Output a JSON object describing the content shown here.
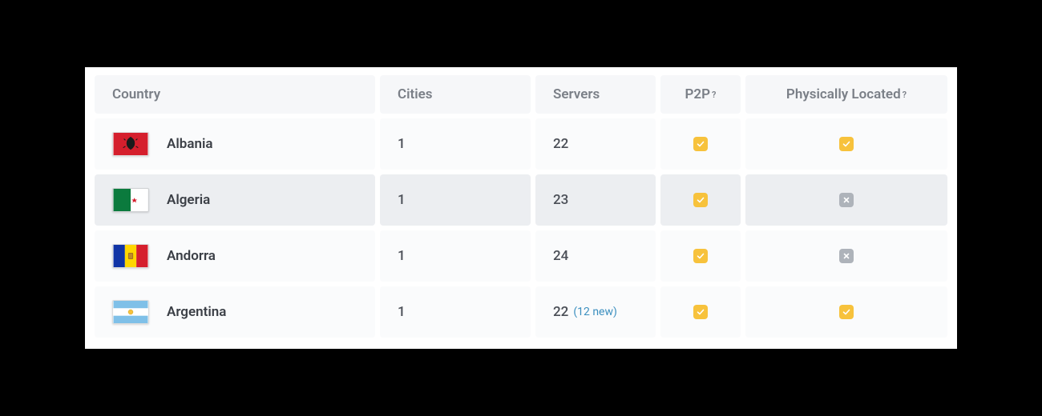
{
  "table": {
    "headers": {
      "country": "Country",
      "cities": "Cities",
      "servers": "Servers",
      "p2p": "P2P",
      "physically_located": "Physically Located",
      "help_marker": "?"
    },
    "rows": [
      {
        "country": "Albania",
        "flag": "al",
        "cities": "1",
        "servers": "22",
        "servers_extra": "",
        "p2p": true,
        "physically_located": true
      },
      {
        "country": "Algeria",
        "flag": "dz",
        "cities": "1",
        "servers": "23",
        "servers_extra": "",
        "p2p": true,
        "physically_located": false
      },
      {
        "country": "Andorra",
        "flag": "ad",
        "cities": "1",
        "servers": "24",
        "servers_extra": "",
        "p2p": true,
        "physically_located": false
      },
      {
        "country": "Argentina",
        "flag": "ar",
        "cities": "1",
        "servers": "22",
        "servers_extra": "(12 new)",
        "p2p": true,
        "physically_located": true
      }
    ]
  }
}
